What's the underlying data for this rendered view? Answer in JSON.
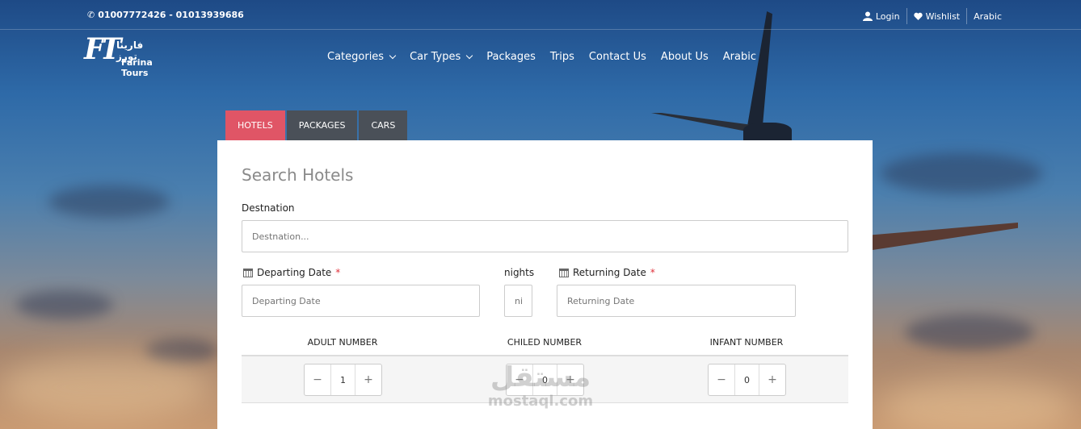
{
  "topbar": {
    "phone": "01007772426 - 01013939686",
    "login": "Login",
    "wishlist": "Wishlist",
    "language": "Arabic"
  },
  "logo": {
    "arabic": "فارينا تورز",
    "english": "Farina Tours",
    "mark": "FT"
  },
  "nav": {
    "categories": "Categories",
    "car_types": "Car Types",
    "packages": "Packages",
    "trips": "Trips",
    "contact": "Contact Us",
    "about": "About Us",
    "arabic": "Arabic"
  },
  "tabs": {
    "hotels": "HOTELS",
    "packages": "PACKAGES",
    "cars": "CARS"
  },
  "search": {
    "title": "Search Hotels",
    "destination_label": "Destnation",
    "destination_placeholder": "Destnation...",
    "departing_label": "Departing Date",
    "departing_placeholder": "Departing Date",
    "nights_label": "nights",
    "nights_placeholder": "ni",
    "returning_label": "Returning Date",
    "returning_placeholder": "Returning Date",
    "required_mark": "*"
  },
  "counts": {
    "adult_label": "ADULT NUMBER",
    "child_label": "CHILED NUMBER",
    "infant_label": "INFANT NUMBER",
    "adult_value": "1",
    "child_value": "0",
    "infant_value": "0",
    "minus": "−",
    "plus": "+"
  },
  "watermark": {
    "arabic": "مستقل",
    "english": "mostaql.com"
  },
  "colors": {
    "active_tab": "#e05566",
    "tab": "#4a5058",
    "required": "#e0303a"
  }
}
